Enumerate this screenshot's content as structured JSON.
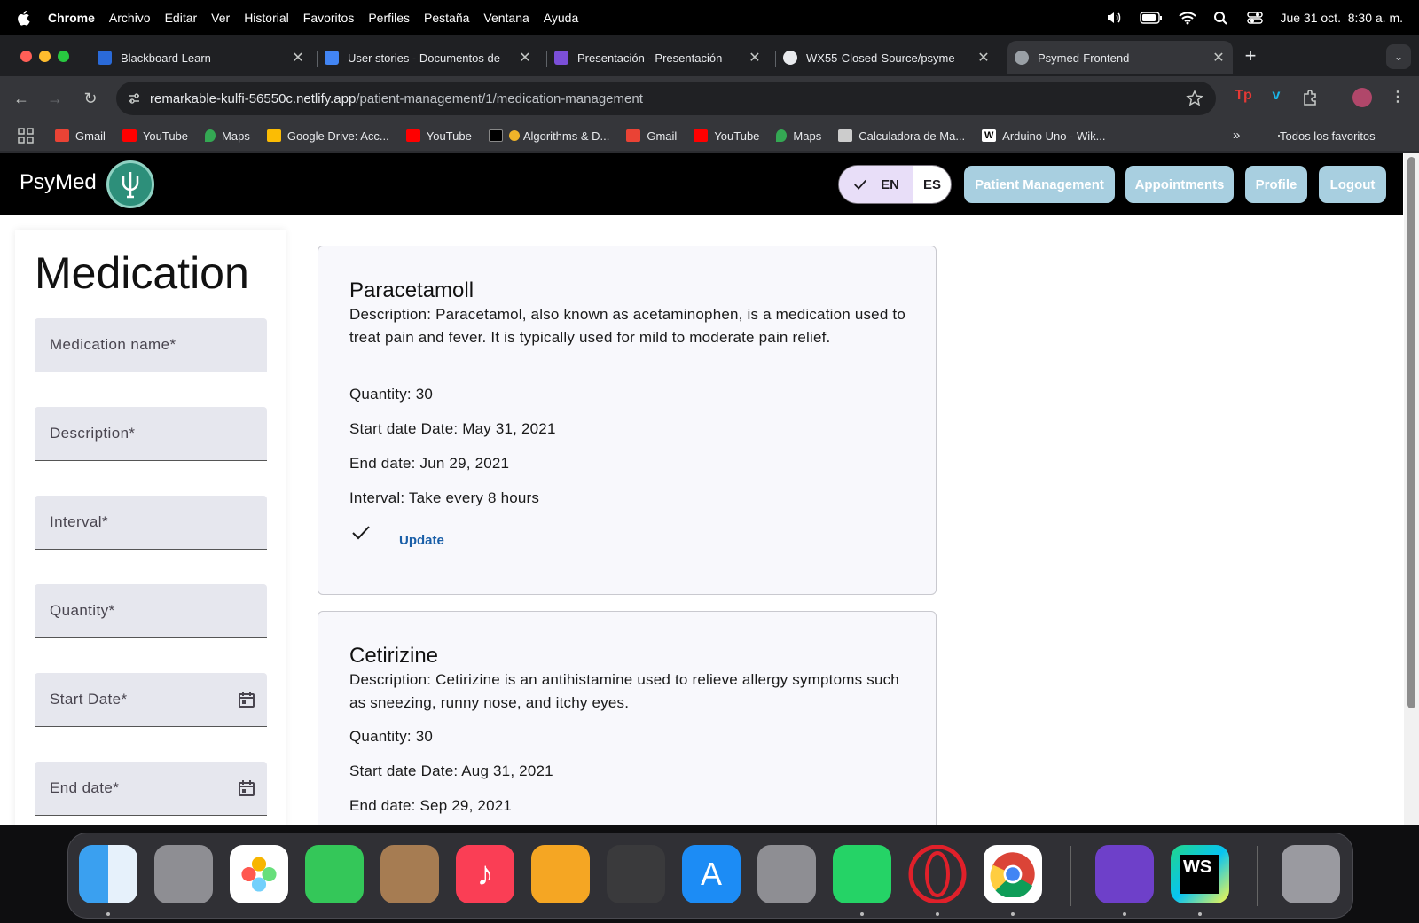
{
  "menubar": {
    "app": "Chrome",
    "items": [
      "Archivo",
      "Editar",
      "Ver",
      "Historial",
      "Favoritos",
      "Perfiles",
      "Pestaña",
      "Ventana",
      "Ayuda"
    ],
    "datetime": "Jue 31 oct.  8:30 a. m."
  },
  "tabs": [
    {
      "title": "Blackboard Learn",
      "favicon_color": "#2a6ad8"
    },
    {
      "title": "User stories - Documentos de",
      "favicon_color": "#4285f4"
    },
    {
      "title": "Presentación - Presentación",
      "favicon_color": "#7b4fd8"
    },
    {
      "title": "WX55-Closed-Source/psyme",
      "favicon_color": "#e8eaed"
    },
    {
      "title": "Psymed-Frontend",
      "favicon_color": "#9aa0a6"
    }
  ],
  "url": {
    "host": "remarkable-kulfi-56550c.netlify.app",
    "path": "/patient-management/1/medication-management"
  },
  "bookmarks": [
    {
      "label": "Gmail",
      "color": "#ea4335"
    },
    {
      "label": "YouTube",
      "color": "#ff0000"
    },
    {
      "label": "Maps",
      "color": "#34a853"
    },
    {
      "label": "Google Drive: Acc...",
      "color": "#fbbc04"
    },
    {
      "label": "YouTube",
      "color": "#ff0000"
    },
    {
      "label": "Algorithms & D...",
      "color": "#f0b429"
    },
    {
      "label": "Gmail",
      "color": "#ea4335"
    },
    {
      "label": "YouTube",
      "color": "#ff0000"
    },
    {
      "label": "Maps",
      "color": "#34a853"
    },
    {
      "label": "Calculadora de Ma...",
      "color": "#cccccc"
    },
    {
      "label": "Arduino Uno - Wik...",
      "color": "#ffffff"
    }
  ],
  "bookmarks_more": "»",
  "bookmarks_all": "Todos los favoritos",
  "app": {
    "brand": "PsyMed",
    "lang_en": "EN",
    "lang_es": "ES",
    "nav": [
      "Patient Management",
      "Appointments",
      "Profile",
      "Logout"
    ]
  },
  "form": {
    "title": "Medication",
    "placeholders": {
      "name": "Medication name*",
      "description": "Description*",
      "interval": "Interval*",
      "quantity": "Quantity*",
      "start": "Start Date*",
      "end": "End date*"
    }
  },
  "medications": [
    {
      "name": "Paracetamoll",
      "description": "Description: Paracetamol, also known as acetaminophen, is a medication used to treat pain and fever. It is typically used for mild to moderate pain relief.",
      "quantity": "Quantity: 30",
      "start": "Start date Date: May 31, 2021",
      "end": "End date: Jun 29, 2021",
      "interval": "Interval: Take every 8 hours",
      "update": "Update"
    },
    {
      "name": "Cetirizine",
      "description": "Description: Cetirizine is an antihistamine used to relieve allergy symptoms such as sneezing, runny nose, and itchy eyes.",
      "quantity": "Quantity: 30",
      "start": "Start date Date: Aug 31, 2021",
      "end": "End date: Sep 29, 2021"
    }
  ],
  "colors": {
    "nav_pill": "#a8cfe0",
    "update_link": "#1a5fa8",
    "header_bg": "#000000"
  },
  "dock": [
    "finder-icon",
    "launchpad-icon",
    "photos-icon",
    "facetime-icon",
    "contacts-icon",
    "music-icon",
    "pages-icon",
    "garageband-icon",
    "app-store-icon",
    "system-settings-icon",
    "whatsapp-icon",
    "opera-icon",
    "chrome-icon",
    "github-desktop-icon",
    "webstorm-icon",
    "trash-icon"
  ]
}
